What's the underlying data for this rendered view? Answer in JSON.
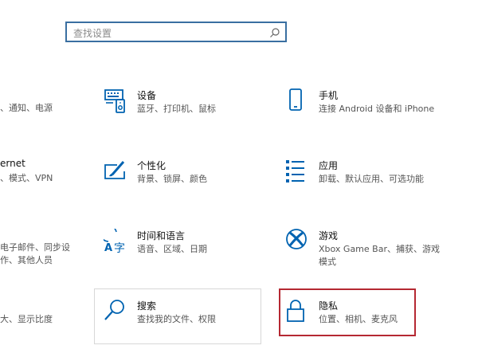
{
  "search": {
    "placeholder": "查找设置"
  },
  "left_fragments": [
    {
      "text": "、通知、电源",
      "kind": "desc"
    },
    {
      "text": "ernet",
      "kind": "title"
    },
    {
      "text": "、模式、VPN",
      "kind": "desc"
    },
    {
      "text": "电子邮件、同步设",
      "kind": "desc"
    },
    {
      "text": "作、其他人员",
      "kind": "desc"
    },
    {
      "text": "大、显示比度",
      "kind": "desc"
    }
  ],
  "tiles": [
    {
      "title": "设备",
      "desc": "蓝牙、打印机、鼠标",
      "icon": "devices-icon"
    },
    {
      "title": "手机",
      "desc": "连接 Android 设备和 iPhone",
      "icon": "phone-icon"
    },
    {
      "title": "个性化",
      "desc": "背景、锁屏、颜色",
      "icon": "personalization-icon"
    },
    {
      "title": "应用",
      "desc": "卸载、默认应用、可选功能",
      "icon": "apps-icon"
    },
    {
      "title": "时间和语言",
      "desc": "语音、区域、日期",
      "icon": "time-language-icon"
    },
    {
      "title": "游戏",
      "desc": "Xbox Game Bar、捕获、游戏",
      "desc2": "模式",
      "icon": "xbox-icon"
    },
    {
      "title": "搜索",
      "desc": "查找我的文件、权限",
      "icon": "search-magnifier-icon"
    },
    {
      "title": "隐私",
      "desc": "位置、相机、麦克风",
      "icon": "lock-icon"
    }
  ],
  "colors": {
    "icon": "#0063b1",
    "search_border": "#3a6fa1",
    "highlight": "#b52832"
  }
}
